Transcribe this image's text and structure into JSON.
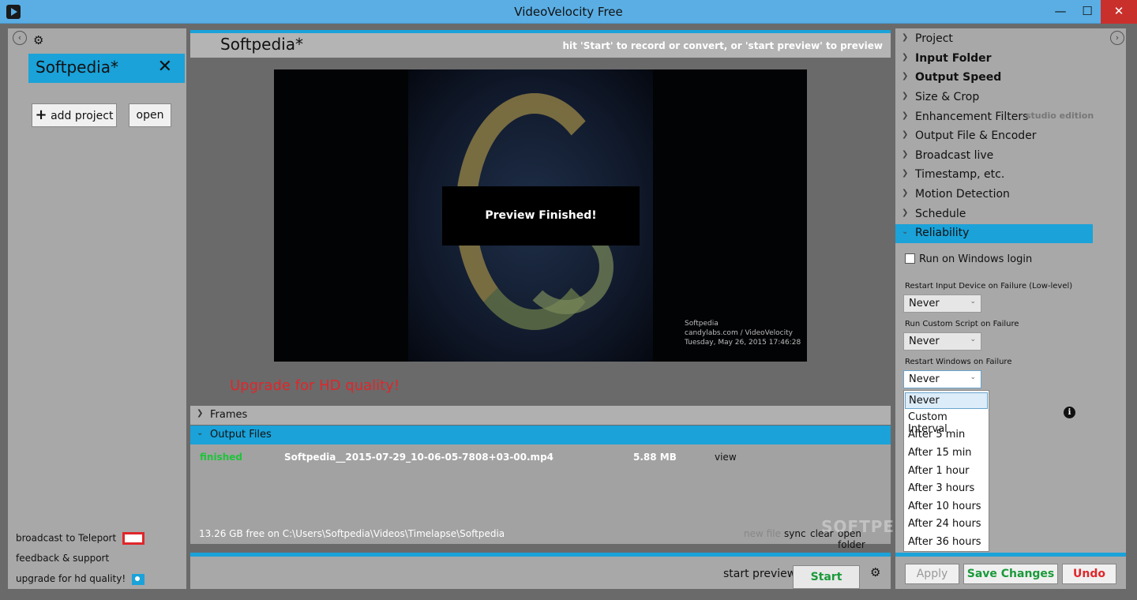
{
  "window": {
    "title": "VideoVelocity Free",
    "minimize": "—",
    "maximize": "☐",
    "close": "✕"
  },
  "left": {
    "back_icon": "‹",
    "gear": "⚙",
    "project_title": "Softpedia*",
    "project_close": "✕",
    "add_project": "add project",
    "add_icon": "+",
    "open": "open",
    "links": {
      "broadcast": "broadcast to Teleport",
      "feedback": "feedback & support",
      "upgrade": "upgrade for hd quality!"
    }
  },
  "center": {
    "title": "Softpedia*",
    "hint": "hit 'Start' to record or convert, or 'start preview' to preview",
    "overlay": "Preview Finished!",
    "watermark": {
      "line1": "Softpedia",
      "line2": "candylabs.com / VideoVelocity",
      "line3": "Tuesday, May 26, 2015 17:46:28"
    },
    "upgrade_hd": "Upgrade for HD quality!",
    "sections": {
      "frames": "Frames",
      "output_files": "Output Files"
    },
    "file": {
      "status": "finished",
      "name": "Softpedia__2015-07-29_10-06-05-7808+03-00.mp4",
      "size": "5.88 MB",
      "view": "view"
    },
    "footer": {
      "free": "13.26 GB free on C:\\Users\\Softpedia\\Videos\\Timelapse\\Softpedia",
      "new_file": "new file",
      "sync": "sync",
      "clear": "clear",
      "open_folder": "open folder"
    },
    "start_preview": "start preview",
    "start": "Start"
  },
  "right": {
    "nav": [
      {
        "label": "Project"
      },
      {
        "label": "Input Folder"
      },
      {
        "label": "Output Speed"
      },
      {
        "label": "Size & Crop"
      },
      {
        "label": "Enhancement Filters"
      },
      {
        "label": "Output File & Encoder"
      },
      {
        "label": "Broadcast live"
      },
      {
        "label": "Timestamp, etc."
      },
      {
        "label": "Motion Detection"
      },
      {
        "label": "Schedule"
      },
      {
        "label": "Reliability"
      }
    ],
    "studio_edition": "studio edition",
    "run_on_login": "Run on Windows login",
    "restart_input_label": "Restart Input Device on Failure (Low-level)",
    "restart_input_value": "Never",
    "run_script_label": "Run Custom Script on Failure",
    "run_script_value": "Never",
    "restart_windows_label": "Restart Windows on Failure",
    "restart_windows_value": "Never",
    "dropdown_options": [
      "Never",
      "Custom Interval",
      "After 5 min",
      "After 15 min",
      "After 1 hour",
      "After 3 hours",
      "After 10 hours",
      "After 24 hours",
      "After 36 hours"
    ],
    "apply": "Apply",
    "save": "Save Changes",
    "undo": "Undo"
  },
  "colors": {
    "accent": "#1aa2d9",
    "green": "#1a9a3a",
    "red": "#e0262a"
  }
}
